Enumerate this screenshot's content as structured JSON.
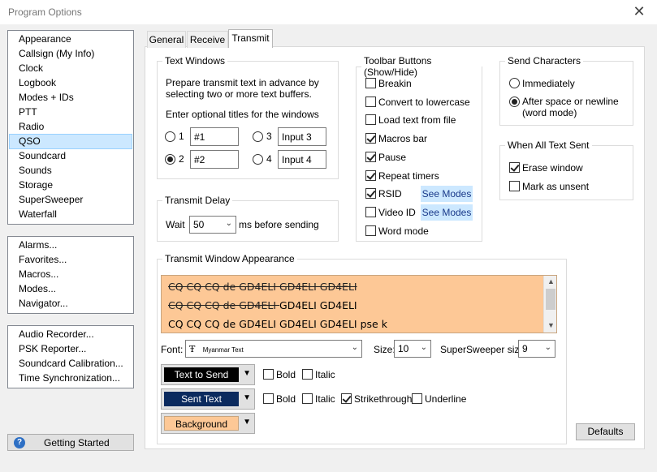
{
  "window": {
    "title": "Program Options",
    "close_glyph": "✕"
  },
  "sidebar": {
    "group1": [
      "Appearance",
      "Callsign (My Info)",
      "Clock",
      "Logbook",
      "Modes + IDs",
      "PTT",
      "Radio",
      "QSO",
      "Soundcard",
      "Sounds",
      "Storage",
      "SuperSweeper",
      "Waterfall"
    ],
    "selected": "QSO",
    "group2": [
      "Alarms...",
      "Favorites...",
      "Macros...",
      "Modes...",
      "Navigator..."
    ],
    "group3": [
      "Audio Recorder...",
      "PSK Reporter...",
      "Soundcard Calibration...",
      "Time Synchronization..."
    ],
    "getting_started": "Getting Started"
  },
  "tabs": [
    "General",
    "Receive",
    "Transmit"
  ],
  "active_tab": "Transmit",
  "text_windows": {
    "legend": "Text Windows",
    "desc1": "Prepare transmit text in advance by",
    "desc2": "selecting two or more text buffers.",
    "desc3": "Enter optional titles for the windows",
    "items": [
      {
        "num": "1",
        "value": "#1",
        "selected": false
      },
      {
        "num": "2",
        "value": "#2",
        "selected": true
      },
      {
        "num": "3",
        "value": "Input 3",
        "selected": false
      },
      {
        "num": "4",
        "value": "Input 4",
        "selected": false
      }
    ]
  },
  "transmit_delay": {
    "legend": "Transmit Delay",
    "wait_label": "Wait",
    "value": "50",
    "suffix": "ms before sending"
  },
  "toolbar_buttons": {
    "legend": "Toolbar Buttons (Show/Hide)",
    "items": [
      {
        "label": "Breakin",
        "checked": false
      },
      {
        "label": "Convert to lowercase",
        "checked": false
      },
      {
        "label": "Load text from file",
        "checked": false
      },
      {
        "label": "Macros bar",
        "checked": true
      },
      {
        "label": "Pause",
        "checked": true
      },
      {
        "label": "Repeat timers",
        "checked": true
      },
      {
        "label": "RSID",
        "checked": true
      },
      {
        "label": "Video ID",
        "checked": false
      },
      {
        "label": "Word mode",
        "checked": false
      }
    ],
    "see_modes": "See Modes"
  },
  "send_characters": {
    "legend": "Send Characters",
    "option1": "Immediately",
    "option2_line1": "After space or newline",
    "option2_line2": "(word mode)",
    "selected": 2
  },
  "when_all_sent": {
    "legend": "When All Text Sent",
    "erase": "Erase window",
    "erase_checked": true,
    "mark": "Mark as unsent",
    "mark_checked": false
  },
  "appearance": {
    "legend": "Transmit Window Appearance",
    "preview_lines": [
      {
        "struck": "CQ CQ CQ de GD4ELI GD4ELI GD4ELI",
        "plain": ""
      },
      {
        "struck": "CQ CQ CQ de GD4ELI ",
        "plain": "GD4ELI GD4ELI"
      },
      {
        "struck": "",
        "plain": "CQ CQ CQ de GD4ELI GD4ELI GD4ELI pse k"
      }
    ],
    "font_label": "Font:",
    "font_icon": "Ŧ",
    "font_value": "Myanmar Text",
    "size_label": "Size:",
    "size_value": "10",
    "ss_size_label": "SuperSweeper size:",
    "ss_size_value": "9",
    "text_to_send": "Text to Send",
    "sent_text": "Sent Text",
    "background": "Background",
    "bold": "Bold",
    "italic": "Italic",
    "strikethrough": "Strikethrough",
    "underline": "Underline",
    "row1_bold": false,
    "row1_italic": false,
    "row2_bold": false,
    "row2_italic": false,
    "row2_strike": true,
    "row2_underline": false
  },
  "defaults_button": "Defaults",
  "colors": {
    "text_send_bg": "#000000",
    "sent_bg": "#0b2a5e",
    "background_bg": "#fdc896"
  }
}
